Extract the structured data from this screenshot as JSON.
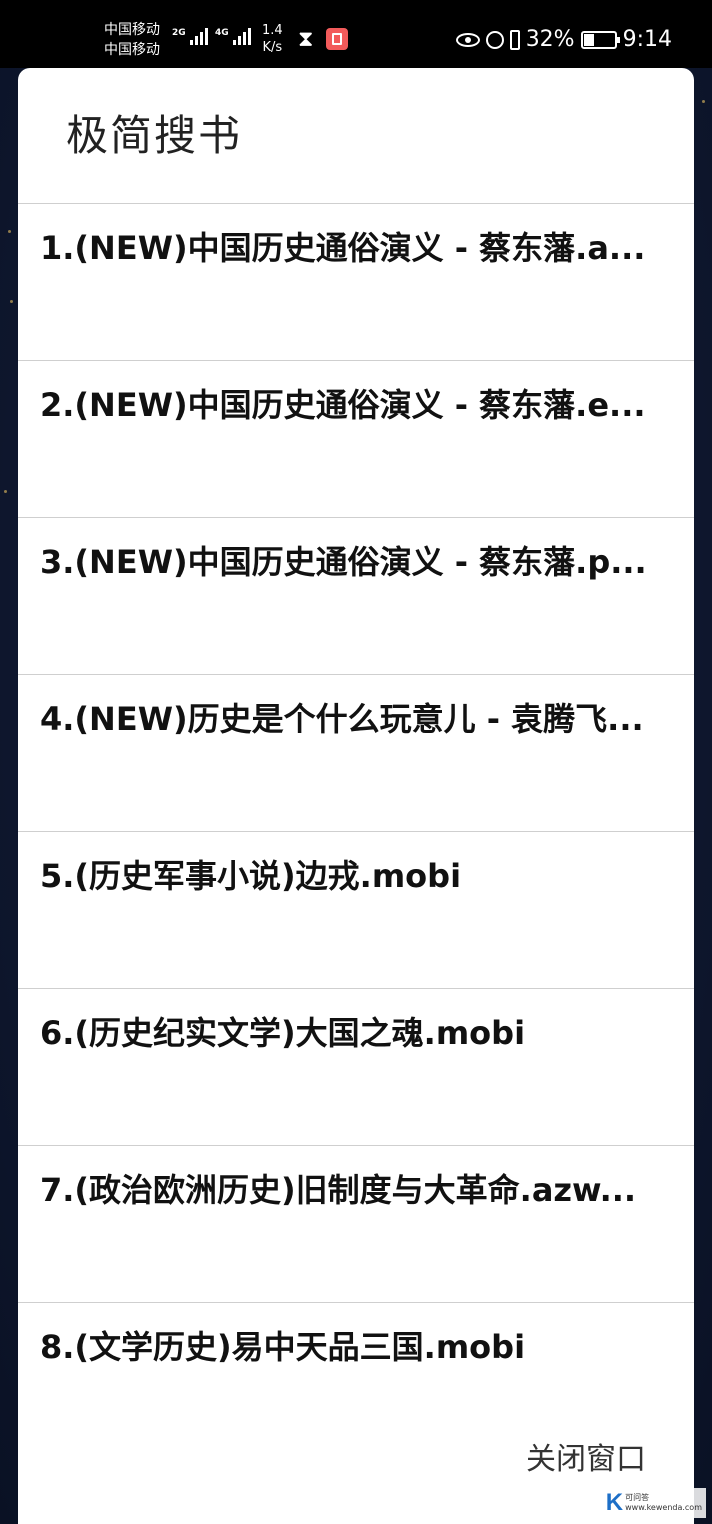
{
  "status_bar": {
    "carrier_1": "中国移动",
    "carrier_2": "中国移动",
    "signal_1_tag": "2G",
    "signal_2_tag": "4G",
    "net_speed_value": "1.4",
    "net_speed_unit": "K/s",
    "battery_percent": "32%",
    "time": "9:14",
    "icons": [
      "hourglass-icon",
      "reader-app-icon",
      "eye-icon",
      "alarm-icon",
      "vibrate-icon",
      "battery-icon"
    ]
  },
  "dialog": {
    "title": "极简搜书",
    "items": [
      {
        "label": "1.(NEW)中国历史通俗演义 - 蔡东藩.a..."
      },
      {
        "label": "2.(NEW)中国历史通俗演义 - 蔡东藩.e..."
      },
      {
        "label": "3.(NEW)中国历史通俗演义 - 蔡东藩.p..."
      },
      {
        "label": "4.(NEW)历史是个什么玩意儿 - 袁腾飞..."
      },
      {
        "label": "5.(历史军事小说)边戎.mobi"
      },
      {
        "label": "6.(历史纪实文学)大国之魂.mobi"
      },
      {
        "label": "7.(政治欧洲历史)旧制度与大革命.azw..."
      },
      {
        "label": "8.(文学历史)易中天品三国.mobi"
      }
    ],
    "close_label": "关闭窗口"
  },
  "watermark": {
    "logo": "K",
    "line_1": "可问答",
    "line_2": "www.kewenda.com"
  }
}
